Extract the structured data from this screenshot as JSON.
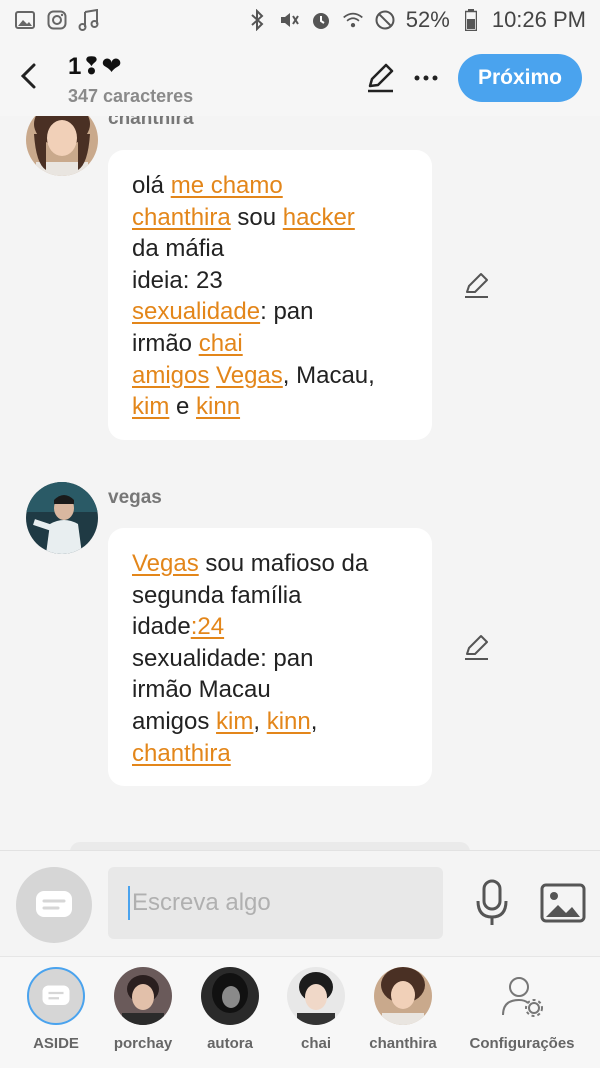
{
  "status_bar": {
    "battery": "52%",
    "time": "10:26 PM"
  },
  "header": {
    "title": "1❢❤",
    "subtitle": "347 caracteres",
    "next_label": "Próximo"
  },
  "messages": [
    {
      "sender": "chanthira",
      "lines": [
        [
          {
            "t": "olá "
          },
          {
            "t": "me chamo",
            "hl": true
          }
        ],
        [
          {
            "t": "chanthira",
            "hl": true
          },
          {
            "t": " sou "
          },
          {
            "t": "hacker",
            "hl": true
          }
        ],
        [
          {
            "t": "da máfia"
          }
        ],
        [
          {
            "t": "ideia: 23"
          }
        ],
        [
          {
            "t": "sexualidade",
            "hl": true
          },
          {
            "t": ": pan"
          }
        ],
        [
          {
            "t": "irmão "
          },
          {
            "t": "chai",
            "hl": true
          }
        ],
        [
          {
            "t": "amigos",
            "hl": true
          },
          {
            "t": " "
          },
          {
            "t": "Vegas",
            "hl": true
          },
          {
            "t": ", Macau,"
          }
        ],
        [
          {
            "t": "kim",
            "hl": true
          },
          {
            "t": " e "
          },
          {
            "t": "kinn",
            "hl": true
          }
        ]
      ]
    },
    {
      "sender": "vegas",
      "lines": [
        [
          {
            "t": "Vegas",
            "hl": true
          },
          {
            "t": " sou mafioso da"
          }
        ],
        [
          {
            "t": "segunda família"
          }
        ],
        [
          {
            "t": "idade"
          },
          {
            "t": ":24",
            "hl": true
          }
        ],
        [
          {
            "t": "sexualidade: pan"
          }
        ],
        [
          {
            "t": "irmão Macau"
          }
        ],
        [
          {
            "t": "amigos "
          },
          {
            "t": "kim",
            "hl": true
          },
          {
            "t": ", "
          },
          {
            "t": "kinn",
            "hl": true
          },
          {
            "t": ","
          }
        ],
        [
          {
            "t": "chanthira",
            "hl": true
          }
        ]
      ]
    }
  ],
  "composer": {
    "placeholder": "Escreva algo"
  },
  "bottom_nav": [
    {
      "label": "ASIDE"
    },
    {
      "label": "porchay"
    },
    {
      "label": "autora"
    },
    {
      "label": "chai"
    },
    {
      "label": "chanthira"
    },
    {
      "label": "Configurações"
    }
  ],
  "colors": {
    "accent": "#4aa3ee",
    "link": "#e3861a"
  }
}
